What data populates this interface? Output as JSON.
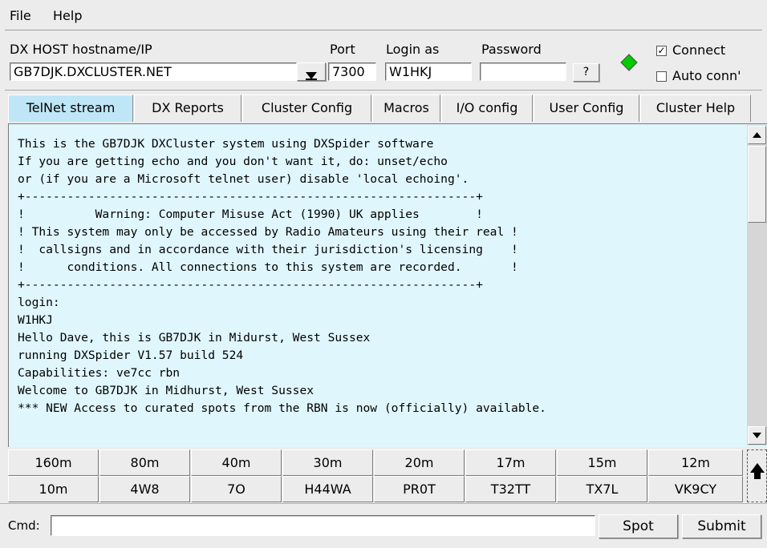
{
  "menu": {
    "file": "File",
    "help": "Help"
  },
  "host": {
    "label": "DX HOST hostname/IP",
    "value": "GB7DJK.DXCLUSTER.NET",
    "port_label": "Port",
    "port_value": "7300",
    "login_label": "Login as",
    "login_value": "W1HKJ",
    "password_label": "Password",
    "password_value": "",
    "help_button": "?",
    "status_color": "#00cc00",
    "connect_label": "Connect",
    "connect_checked": true,
    "autoconn_label": "Auto conn'",
    "autoconn_checked": false
  },
  "tabs": [
    "TelNet stream",
    "DX Reports",
    "Cluster Config",
    "Macros",
    "I/O config",
    "User Config",
    "Cluster Help"
  ],
  "active_tab": "TelNet stream",
  "terminal": {
    "lines": [
      "This is the GB7DJK DXCluster system using DXSpider software",
      "If you are getting echo and you don't want it, do: unset/echo",
      "or (if you are a Microsoft telnet user) disable 'local echoing'.",
      "+----------------------------------------------------------------+",
      "!          Warning: Computer Misuse Act (1990) UK applies        !",
      "! This system may only be accessed by Radio Amateurs using their real !",
      "!  callsigns and in accordance with their jurisdiction's licensing    !",
      "!      conditions. All connections to this system are recorded.       !",
      "+----------------------------------------------------------------+",
      "login:",
      "W1HKJ",
      "Hello Dave, this is GB7DJK in Midurst, West Sussex",
      "running DXSpider V1.57 build 524",
      "Capabilities: ve7cc rbn",
      "Welcome to GB7DJK in Midhurst, West Sussex",
      "*** NEW Access to curated spots from the RBN is now (officially) available."
    ]
  },
  "bands_row1": [
    "160m",
    "80m",
    "40m",
    "30m",
    "20m",
    "17m",
    "15m",
    "12m"
  ],
  "bands_row2": [
    "10m",
    "4W8",
    "7O",
    "H44WA",
    "PR0T",
    "T32TT",
    "TX7L",
    "VK9CY"
  ],
  "cmd": {
    "label": "Cmd:",
    "value": "",
    "spot": "Spot",
    "submit": "Submit"
  }
}
